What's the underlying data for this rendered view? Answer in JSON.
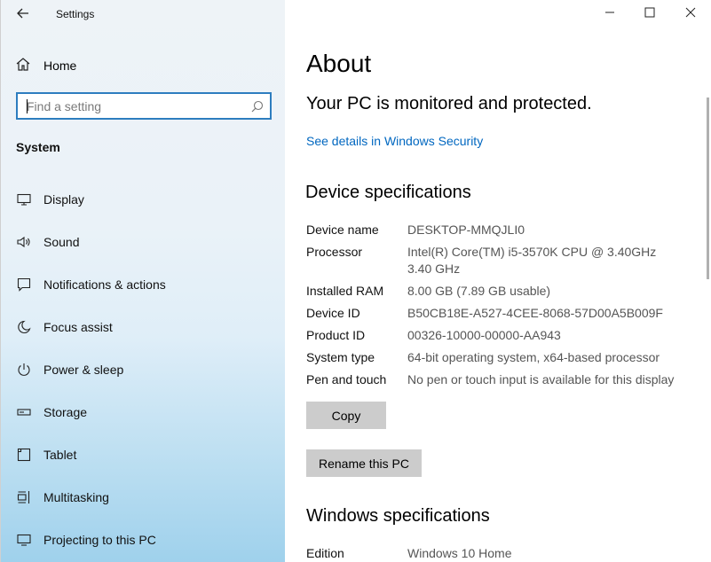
{
  "app": {
    "title": "Settings"
  },
  "sidebar": {
    "home_label": "Home",
    "search_placeholder": "Find a setting",
    "section_title": "System",
    "items": [
      {
        "label": "Display",
        "icon": "monitor-icon"
      },
      {
        "label": "Sound",
        "icon": "speaker-icon"
      },
      {
        "label": "Notifications & actions",
        "icon": "notification-icon"
      },
      {
        "label": "Focus assist",
        "icon": "moon-icon"
      },
      {
        "label": "Power & sleep",
        "icon": "power-icon"
      },
      {
        "label": "Storage",
        "icon": "storage-icon"
      },
      {
        "label": "Tablet",
        "icon": "tablet-icon"
      },
      {
        "label": "Multitasking",
        "icon": "multitasking-icon"
      },
      {
        "label": "Projecting to this PC",
        "icon": "projecting-icon"
      }
    ]
  },
  "main": {
    "title": "About",
    "status_text": "Your PC is monitored and protected.",
    "security_link": "See details in Windows Security",
    "device_specs": {
      "heading": "Device specifications",
      "rows": [
        {
          "key": "Device name",
          "value": "DESKTOP-MMQJLI0"
        },
        {
          "key": "Processor",
          "value": "Intel(R) Core(TM) i5-3570K CPU @ 3.40GHz   3.40 GHz"
        },
        {
          "key": "Installed RAM",
          "value": "8.00 GB (7.89 GB usable)"
        },
        {
          "key": "Device ID",
          "value": "B50CB18E-A527-4CEE-8068-57D00A5B009F"
        },
        {
          "key": "Product ID",
          "value": "00326-10000-00000-AA943"
        },
        {
          "key": "System type",
          "value": "64-bit operating system, x64-based processor"
        },
        {
          "key": "Pen and touch",
          "value": "No pen or touch input is available for this display"
        }
      ],
      "copy_button": "Copy",
      "rename_button": "Rename this PC"
    },
    "windows_specs": {
      "heading": "Windows specifications",
      "rows": [
        {
          "key": "Edition",
          "value": "Windows 10 Home"
        }
      ]
    }
  },
  "colors": {
    "accent": "#0067c0",
    "search_border": "#2d7dbf",
    "button_bg": "#cccccc"
  }
}
